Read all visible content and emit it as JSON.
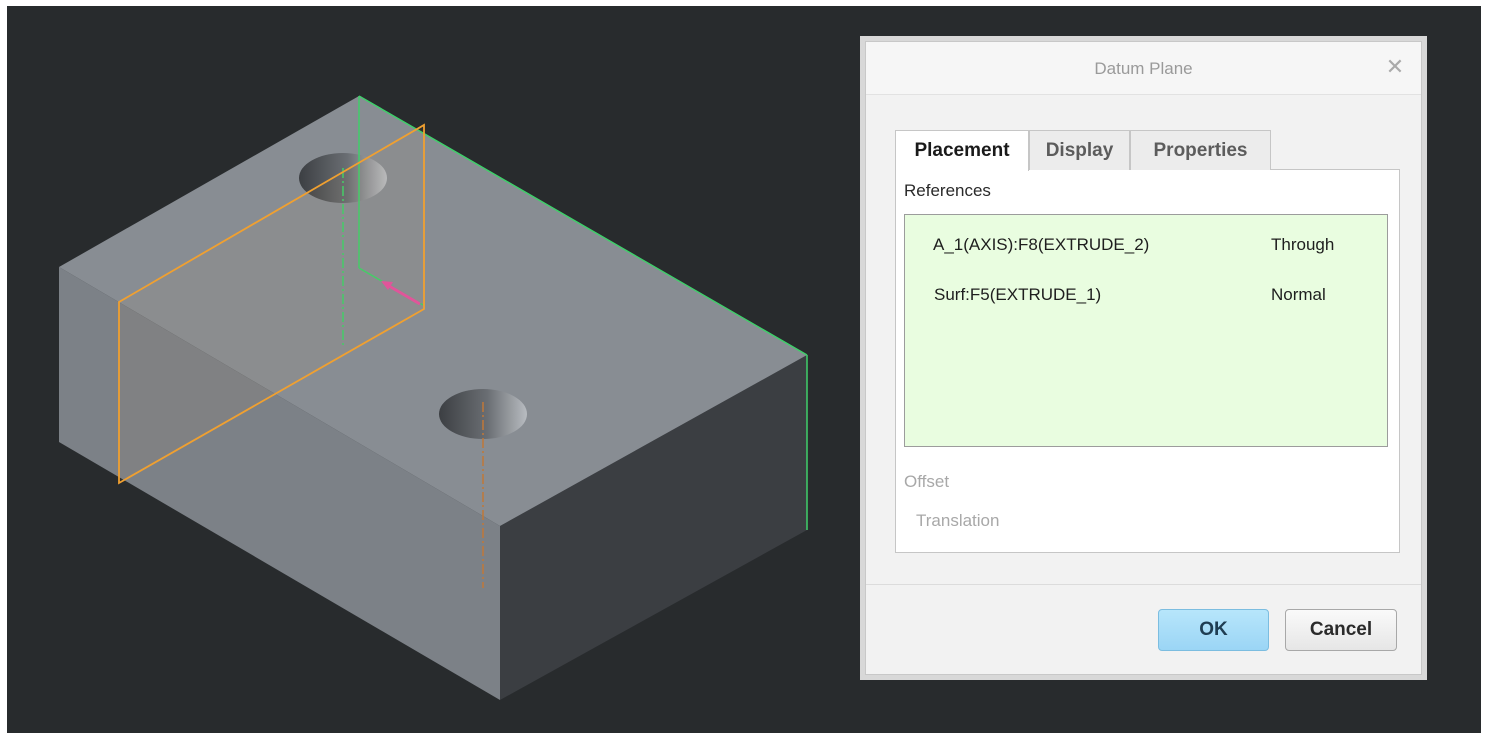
{
  "dialog": {
    "title": "Datum Plane",
    "close_icon": "close-icon",
    "tabs": [
      {
        "label": "Placement",
        "active": true
      },
      {
        "label": "Display",
        "active": false
      },
      {
        "label": "Properties",
        "active": false
      }
    ],
    "references_label": "References",
    "references": [
      {
        "name": "A_1(AXIS):F8(EXTRUDE_2)",
        "constraint": "Through"
      },
      {
        "name": "Surf:F5(EXTRUDE_1)",
        "constraint": "Normal"
      }
    ],
    "offset_label": "Offset",
    "translation_label": "Translation",
    "ok_label": "OK",
    "cancel_label": "Cancel"
  },
  "colors": {
    "viewport_bg": "#282b2d",
    "references_bg": "#e9fde0",
    "datum_plane_preview": "#f0a030",
    "placement_reference": "#3fcf6a",
    "ok_button": "#a9ddf8"
  }
}
